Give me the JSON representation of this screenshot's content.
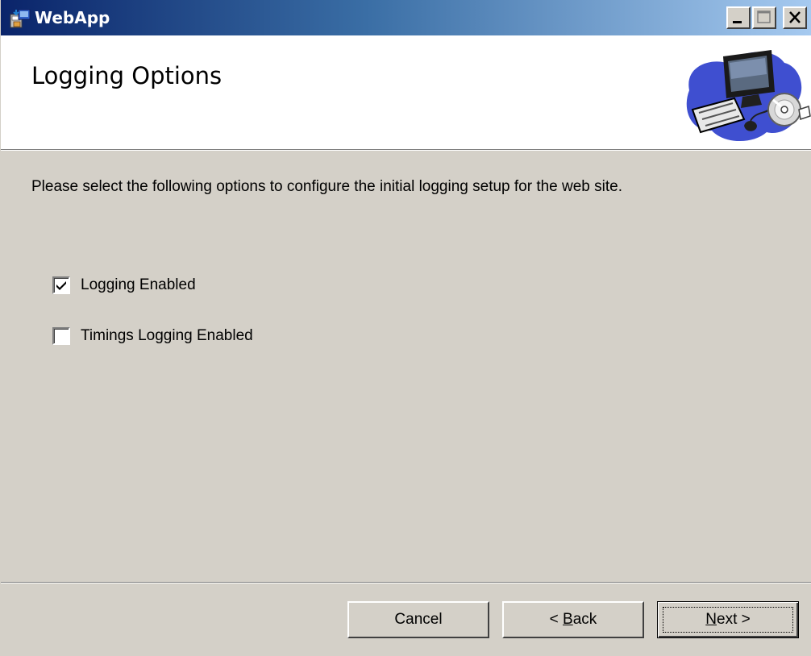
{
  "window": {
    "title": "WebApp",
    "controls": {
      "minimize": "minimize",
      "maximize": "maximize",
      "close": "close"
    }
  },
  "banner": {
    "title": "Logging Options",
    "art_icon": "computer-illustration-icon"
  },
  "description": "Please select the following options to configure the initial logging setup for the web site.",
  "options": [
    {
      "label": "Logging Enabled",
      "checked": true
    },
    {
      "label": "Timings Logging Enabled",
      "checked": false
    }
  ],
  "buttons": {
    "cancel": "Cancel",
    "back_prefix": "< ",
    "back_accel": "B",
    "back_rest": "ack",
    "next_accel": "N",
    "next_rest": "ext >"
  },
  "colors": {
    "titlebar_start": "#0a246a",
    "titlebar_end": "#a6caf0",
    "face": "#d4d0c8",
    "banner": "#ffffff"
  }
}
